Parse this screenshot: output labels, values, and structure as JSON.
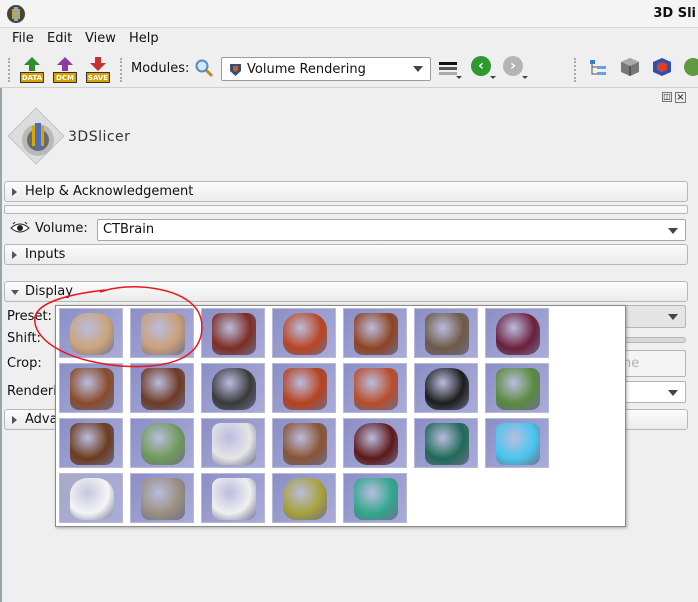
{
  "window": {
    "title": "3D Sli"
  },
  "menu": [
    {
      "label": "File"
    },
    {
      "label": "Edit"
    },
    {
      "label": "View"
    },
    {
      "label": "Help"
    }
  ],
  "toolbar": {
    "data_label": "DATA",
    "dcm_label": "DCM",
    "save_label": "SAVE",
    "modules_label": "Modules:",
    "module_selected": "Volume Rendering"
  },
  "logo": {
    "text": "3DSlicer"
  },
  "sections": {
    "help": "Help & Acknowledgement",
    "inputs": "Inputs",
    "display": "Display",
    "advanced": "Adva"
  },
  "volume": {
    "label": "Volume:",
    "value": "CTBrain"
  },
  "display": {
    "preset_label": "Preset:",
    "shift_label": "Shift:",
    "crop_label": "Crop:",
    "rendering_label": "Renderi",
    "crop_widget_partial": "ne"
  },
  "annotation": {
    "color": "#e8141e"
  },
  "presets": {
    "count": 26,
    "columns": 7,
    "thumbnails": [
      {
        "name": "bone-torso-light",
        "bg": "#8b8fc6",
        "fg": "#caa57a"
      },
      {
        "name": "bone-torso-light-2",
        "bg": "#8b8fc6",
        "fg": "#c9a07a"
      },
      {
        "name": "muscle-torso",
        "bg": "#8b8fc6",
        "fg": "#7e2d23"
      },
      {
        "name": "ct-chest-red",
        "bg": "#8b8fc6",
        "fg": "#b94522"
      },
      {
        "name": "ct-cardiac",
        "bg": "#8b8fc6",
        "fg": "#8f4422"
      },
      {
        "name": "ct-cardiac-2",
        "bg": "#8b8fc6",
        "fg": "#6e5a46"
      },
      {
        "name": "ct-cardiac-3",
        "bg": "#8b8fc6",
        "fg": "#6b1f3a"
      },
      {
        "name": "ct-torso-brown",
        "bg": "#8b8fc6",
        "fg": "#8a4b2b"
      },
      {
        "name": "ct-torso-soft",
        "bg": "#8b8fc6",
        "fg": "#6e3a24"
      },
      {
        "name": "ct-bone-gray",
        "bg": "#8b8fc6",
        "fg": "#3a3a3a"
      },
      {
        "name": "ct-ribcage",
        "bg": "#8b8fc6",
        "fg": "#b6421e"
      },
      {
        "name": "ct-ribcage-2",
        "bg": "#8b8fc6",
        "fg": "#b84d2a"
      },
      {
        "name": "ct-black",
        "bg": "#8b8fc6",
        "fg": "#1d1d1d"
      },
      {
        "name": "ct-green-body",
        "bg": "#8b8fc6",
        "fg": "#5a8a3c"
      },
      {
        "name": "ct-skeleton-brown",
        "bg": "#8b8fc6",
        "fg": "#6b3c1e"
      },
      {
        "name": "ct-green-figure",
        "bg": "#8b8fc6",
        "fg": "#6f9a5a"
      },
      {
        "name": "ct-white-chest",
        "bg": "#8b8fc6",
        "fg": "#e5e5e5"
      },
      {
        "name": "ct-skin",
        "bg": "#8b8fc6",
        "fg": "#8a5434"
      },
      {
        "name": "mr-head-red",
        "bg": "#8b8fc6",
        "fg": "#5e1818"
      },
      {
        "name": "mr-head-color",
        "bg": "#8b8fc6",
        "fg": "#1f6a58"
      },
      {
        "name": "ct-lungs-blue",
        "bg": "#8b8fc6",
        "fg": "#48c6ee"
      },
      {
        "name": "mr-angio-white",
        "bg": "#a8aac8",
        "fg": "#f5f5f5"
      },
      {
        "name": "ct-skull-gray",
        "bg": "#8b8fc6",
        "fg": "#9a9080"
      },
      {
        "name": "mr-angio-2",
        "bg": "#8b8fc6",
        "fg": "#f0f0f0"
      },
      {
        "name": "mr-brain-yellow",
        "bg": "#8b8fc6",
        "fg": "#a7a13a"
      },
      {
        "name": "mr-brain-teal",
        "bg": "#8b8fc6",
        "fg": "#31a88d"
      }
    ]
  }
}
